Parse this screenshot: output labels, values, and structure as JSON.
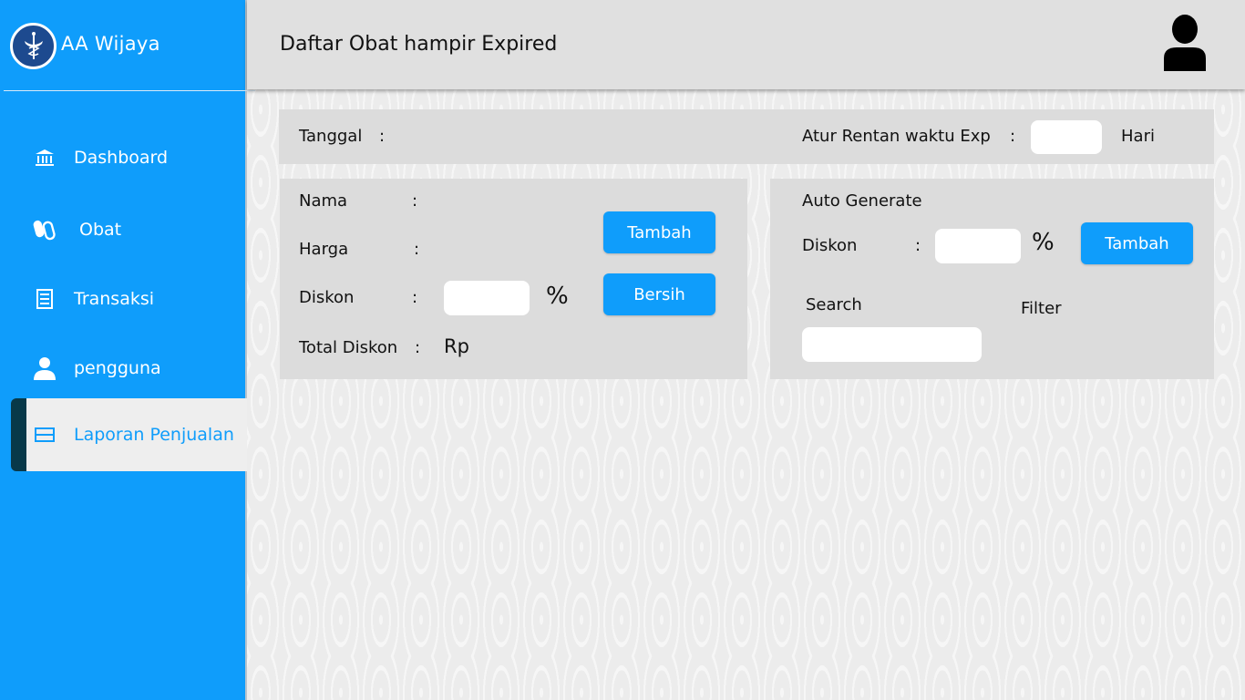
{
  "app": {
    "name": "AA Wijaya",
    "accent_color": "#0f9dfb",
    "logo_icon": "pharmacy-caduceus-icon"
  },
  "sidebar": {
    "items": [
      {
        "label": "Dashboard",
        "icon": "bank-icon",
        "active": false
      },
      {
        "label": "Obat",
        "icon": "pills-icon",
        "active": false
      },
      {
        "label": "Transaksi",
        "icon": "receipt-icon",
        "active": false
      },
      {
        "label": "pengguna",
        "icon": "user-icon",
        "active": false
      },
      {
        "label": "Laporan Penjualan",
        "icon": "list-icon",
        "active": true
      }
    ]
  },
  "header": {
    "title": "Daftar Obat hampir Expired",
    "avatar_icon": "user-avatar-icon"
  },
  "top_bar": {
    "tanggal_label": "Tanggal",
    "colon": ":",
    "range_label": "Atur Rentan waktu Exp",
    "range_value": "",
    "range_unit": "Hari"
  },
  "form": {
    "nama_label": "Nama",
    "harga_label": "Harga",
    "diskon_label": "Diskon",
    "diskon_value": "",
    "percent": "%",
    "total_diskon_label": "Total Diskon",
    "currency": "Rp",
    "colon": ":",
    "tambah_label": "Tambah",
    "bersih_label": "Bersih"
  },
  "auto": {
    "title": "Auto Generate",
    "diskon_label": "Diskon",
    "colon": ":",
    "diskon_value": "",
    "percent": "%",
    "tambah_label": "Tambah",
    "search_label": "Search",
    "search_value": "",
    "filter_label": "Filter"
  }
}
